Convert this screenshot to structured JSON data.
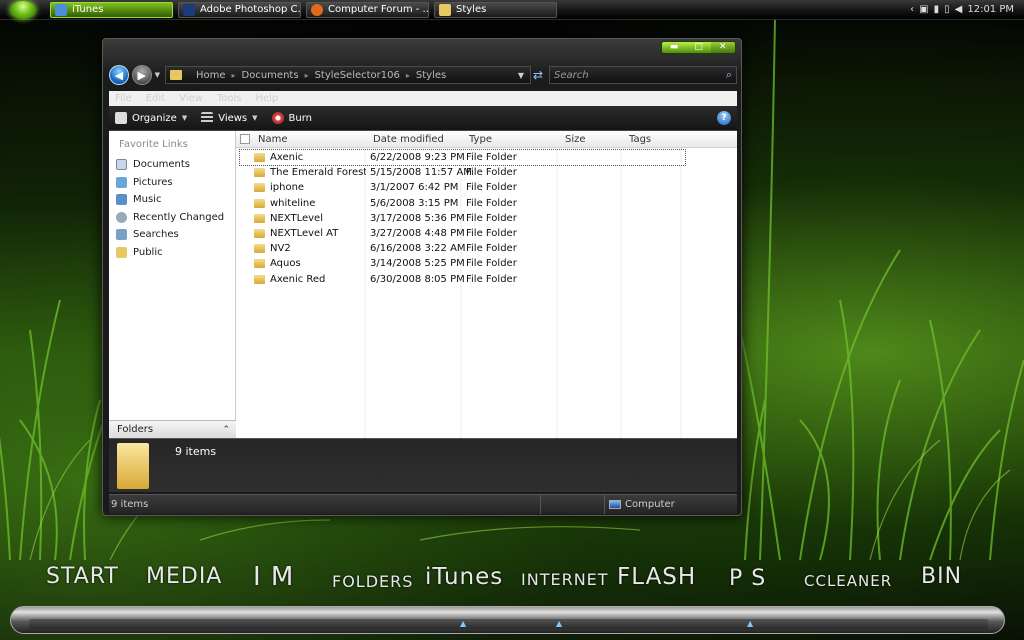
{
  "colors": {
    "accent_green": "#7fc21a",
    "accent_blue": "#1a6fc8",
    "folder_yellow": "#e8c860"
  },
  "taskbar": {
    "start_orb": "vista-orb-icon",
    "tasks": [
      {
        "label": "iTunes",
        "icon": "itunes-icon",
        "active": true
      },
      {
        "label": "Adobe Photoshop C...",
        "icon": "photoshop-icon",
        "active": false
      },
      {
        "label": "Computer Forum - ...",
        "icon": "firefox-icon",
        "active": false
      },
      {
        "label": "Styles",
        "icon": "folder-icon",
        "active": false
      }
    ],
    "tray": {
      "show_hidden": "‹",
      "clock": "12:01 PM"
    }
  },
  "window": {
    "caption_buttons": {
      "minimize": "▬",
      "maximize": "□",
      "close": "✕"
    },
    "address": {
      "crumbs": [
        "Home",
        "Documents",
        "StyleSelector106",
        "Styles"
      ]
    },
    "search": {
      "placeholder": "Search"
    },
    "menu": [
      "File",
      "Edit",
      "View",
      "Tools",
      "Help"
    ],
    "toolbar": {
      "organize": "Organize",
      "views": "Views",
      "burn": "Burn"
    },
    "nav_pane": {
      "title": "Favorite Links",
      "items": [
        {
          "label": "Documents",
          "icon": "documents-icon"
        },
        {
          "label": "Pictures",
          "icon": "pictures-icon"
        },
        {
          "label": "Music",
          "icon": "music-icon"
        },
        {
          "label": "Recently Changed",
          "icon": "recent-icon"
        },
        {
          "label": "Searches",
          "icon": "searches-icon"
        },
        {
          "label": "Public",
          "icon": "public-folder-icon"
        }
      ],
      "folders_label": "Folders"
    },
    "columns": {
      "name": "Name",
      "date": "Date modified",
      "type": "Type",
      "size": "Size",
      "tags": "Tags"
    },
    "files": [
      {
        "name": "Axenic",
        "date": "6/22/2008 9:23 PM",
        "type": "File Folder",
        "selected": true
      },
      {
        "name": "The Emerald Forest",
        "date": "5/15/2008 11:57 AM",
        "type": "File Folder"
      },
      {
        "name": "iphone",
        "date": "3/1/2007 6:42 PM",
        "type": "File Folder"
      },
      {
        "name": "whiteline",
        "date": "5/6/2008 3:15 PM",
        "type": "File Folder"
      },
      {
        "name": "NEXTLevel",
        "date": "3/17/2008 5:36 PM",
        "type": "File Folder"
      },
      {
        "name": "NEXTLevel AT",
        "date": "3/27/2008 4:48 PM",
        "type": "File Folder"
      },
      {
        "name": "NV2",
        "date": "6/16/2008 3:22 AM",
        "type": "File Folder"
      },
      {
        "name": "Aquos",
        "date": "3/14/2008 5:25 PM",
        "type": "File Folder"
      },
      {
        "name": "Axenic Red",
        "date": "6/30/2008 8:05 PM",
        "type": "File Folder"
      }
    ],
    "details": {
      "count": "9 items"
    },
    "status": {
      "left": "9 items",
      "right": "Computer"
    }
  },
  "dock": {
    "items": [
      "START",
      "MEDIA",
      "I M",
      "FOLDERS",
      "iTunes",
      "INTERNET",
      "FLASH",
      "P S",
      "CCLEANER",
      "BIN"
    ]
  }
}
